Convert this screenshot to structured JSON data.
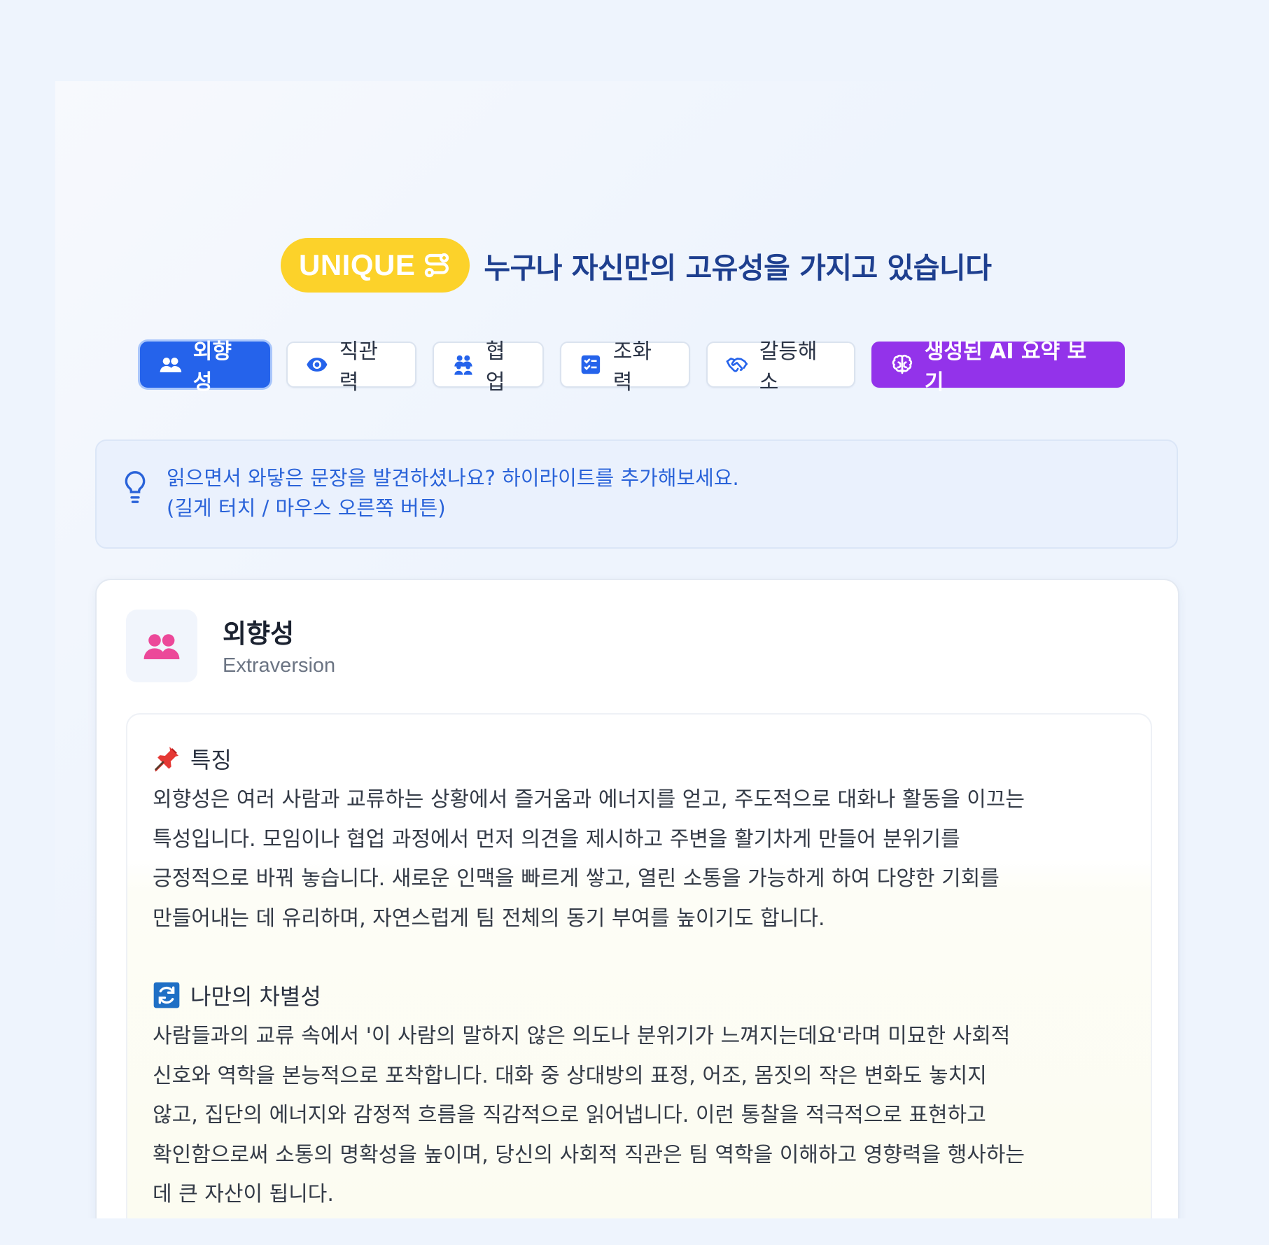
{
  "header": {
    "badge": "UNIQUE",
    "badge_icon": "route-icon",
    "title": "누구나 자신만의 고유성을 가지고 있습니다"
  },
  "tabs": [
    {
      "label": "외향성",
      "icon": "users-icon",
      "active": true
    },
    {
      "label": "직관력",
      "icon": "eye-icon",
      "active": false
    },
    {
      "label": "협업",
      "icon": "group-icon",
      "active": false
    },
    {
      "label": "조화력",
      "icon": "checklist-icon",
      "active": false
    },
    {
      "label": "갈등해소",
      "icon": "handshake-icon",
      "active": false
    },
    {
      "label": "생성된 AI 요약 보기",
      "icon": "brain-icon",
      "active": false
    }
  ],
  "tip": {
    "icon": "lightbulb-icon",
    "line1": "읽으면서 와닿은 문장을 발견하셨나요? 하이라이트를 추가해보세요.",
    "line2": "(길게 터치 / 마우스 오른쪽 버튼)"
  },
  "card": {
    "title": "외향성",
    "subtitle": "Extraversion",
    "sections": [
      {
        "icon": "pushpin-icon",
        "heading": "특징",
        "lines": [
          "외향성은 여러 사람과 교류하는 상황에서 즐거움과 에너지를 얻고, 주도적으로 대화나 활동을 이끄는",
          "특성입니다. 모임이나 협업 과정에서 먼저 의견을 제시하고 주변을 활기차게 만들어 분위기를",
          "긍정적으로 바꿔 놓습니다. 새로운 인맥을 빠르게 쌓고, 열린 소통을 가능하게 하여 다양한 기회를",
          "만들어내는 데 유리하며, 자연스럽게 팀 전체의 동기 부여를 높이기도 합니다."
        ]
      },
      {
        "icon": "refresh-icon",
        "heading": "나만의 차별성",
        "lines": [
          "사람들과의 교류 속에서 '이 사람의 말하지 않은 의도나 분위기가 느껴지는데요'라며 미묘한 사회적",
          "신호와 역학을 본능적으로 포착합니다. 대화 중 상대방의 표정, 어조, 몸짓의 작은 변화도 놓치지",
          "않고, 집단의 에너지와 감정적 흐름을 직감적으로 읽어냅니다. 이런 통찰을 적극적으로 표현하고",
          "확인함으로써 소통의 명확성을 높이며, 당신의 사회적 직관은 팀 역학을 이해하고 영향력을 행사하는",
          "데 큰 자산이 됩니다."
        ]
      }
    ]
  },
  "colors": {
    "primary": "#2563eb",
    "ai_purple": "#9333ea",
    "badge_yellow": "#fcd22a",
    "title_navy": "#1e3f8f",
    "icon_pink": "#ec4899"
  }
}
